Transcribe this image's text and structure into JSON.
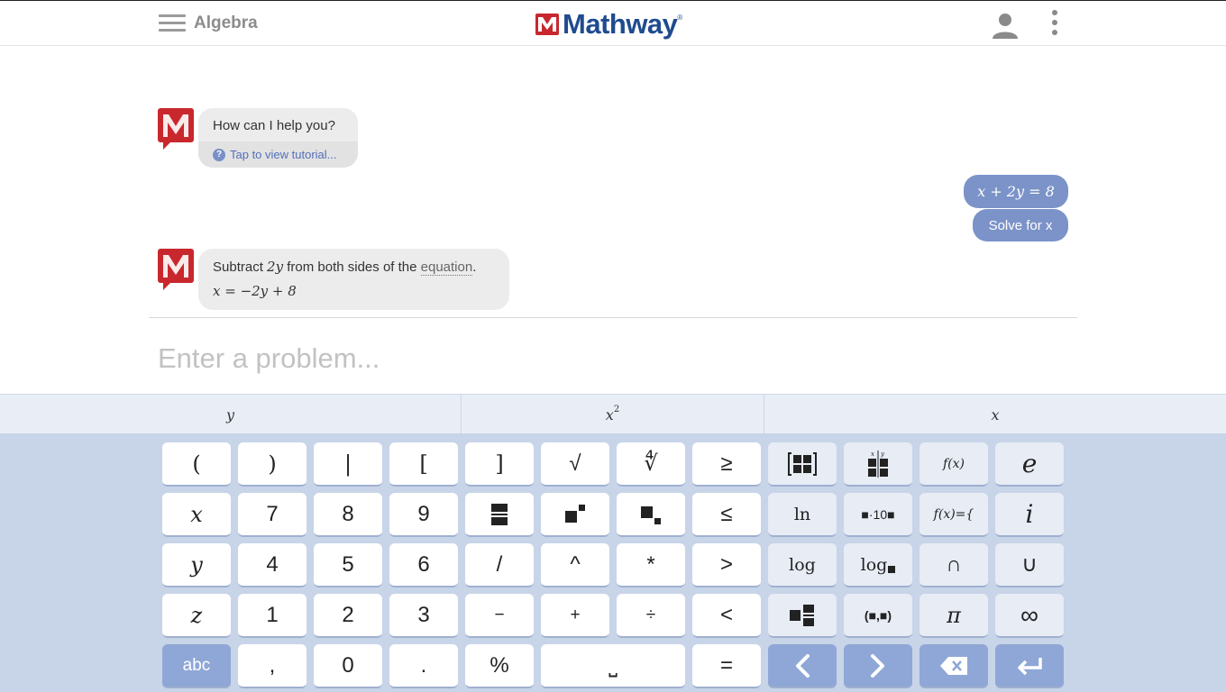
{
  "header": {
    "subject": "Algebra",
    "logo_text": "Mathway",
    "logo_tm": "®"
  },
  "chat": {
    "greeting": "How can I help you?",
    "tutorial": "Tap to view tutorial...",
    "user_expr": "x + 2y = 8",
    "user_task": "Solve for x",
    "step_pre": "Subtract ",
    "step_term": "2y",
    "step_mid": " from both sides of the ",
    "step_link": "equation",
    "step_post": ".",
    "step_result": "x = −2y + 8"
  },
  "input": {
    "placeholder": "Enter a problem..."
  },
  "suggestions": [
    {
      "label": "y"
    },
    {
      "label": "x",
      "sup": "2"
    },
    {
      "label": "x"
    }
  ],
  "keys": {
    "open_paren": "(",
    "close_paren": ")",
    "abs": "|",
    "open_bracket": "[",
    "close_bracket": "]",
    "sqrt": "√",
    "nthroot": "∜",
    "geq": "≥",
    "fx": "f(x)",
    "e": "e",
    "x": "x",
    "seven": "7",
    "eight": "8",
    "nine": "9",
    "leq": "≤",
    "ln": "ln",
    "sci": "■·10■",
    "piecewise": "f(x)={",
    "i": "i",
    "y": "y",
    "four": "4",
    "five": "5",
    "six": "6",
    "slash": "/",
    "caret": "^",
    "star": "*",
    "gt": ">",
    "log": "log",
    "logb": "log",
    "intersect": "∩",
    "union": "∪",
    "z": "z",
    "one": "1",
    "two": "2",
    "three": "3",
    "minus": "−",
    "plus": "+",
    "divide": "÷",
    "lt": "<",
    "interval": "(■,■)",
    "pi": "π",
    "inf": "∞",
    "abc": "abc",
    "comma": ",",
    "zero": "0",
    "dot": ".",
    "percent": "%",
    "space": "⎵",
    "equals": "="
  },
  "colors": {
    "user_bubble": "#7b93c8",
    "bot_bubble": "#ececec",
    "keypad_bg": "#c8d4e8",
    "logo_blue": "#1f4b8f",
    "logo_red": "#c8282d"
  }
}
